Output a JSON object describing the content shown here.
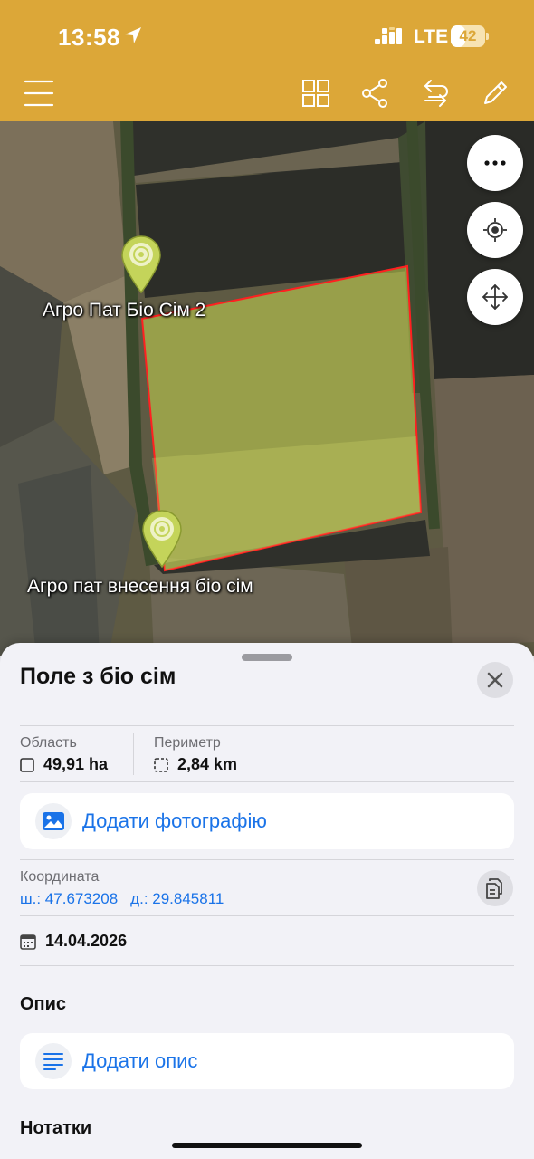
{
  "status": {
    "time": "13:58",
    "network": "LTE",
    "battery": "42",
    "battery_level": 0.42
  },
  "toolbar": {
    "icons": [
      "menu-icon",
      "grid-icon",
      "share-icon",
      "swap-icon",
      "edit-icon"
    ]
  },
  "map": {
    "labels": [
      "Агро Пат Біо Сім 2",
      "Агро пат внесення біо сім"
    ],
    "field_color": "#c8d850",
    "outline_color": "#ff2020"
  },
  "map_controls": [
    "more-icon",
    "locate-icon",
    "move-icon"
  ],
  "sheet": {
    "title": "Поле з біо сім",
    "area_label": "Область",
    "area_value": "49,91 ha",
    "perimeter_label": "Периметр",
    "perimeter_value": "2,84 km",
    "add_photo": "Додати фотографію",
    "coord_label": "Координата",
    "lat": "ш.: 47.673208",
    "lon": "д.: 29.845811",
    "date": "14.04.2026",
    "description_title": "Опис",
    "add_description": "Додати опис",
    "notes_title": "Нотатки"
  },
  "colors": {
    "accent": "#dca738",
    "link": "#1a73e8"
  }
}
